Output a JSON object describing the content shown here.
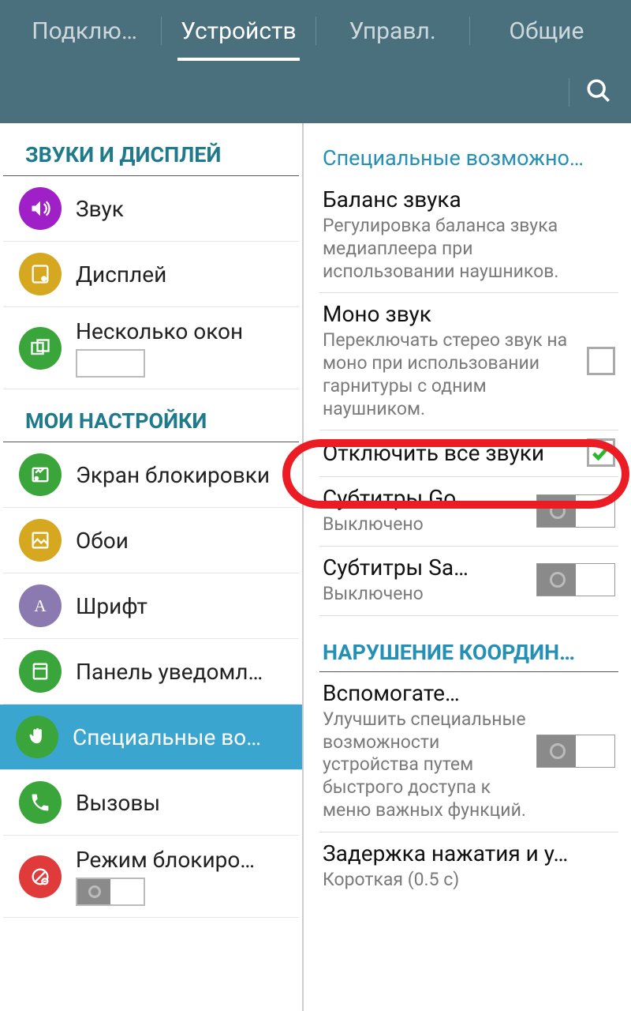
{
  "tabs": {
    "t0": "Подклю…",
    "t1": "Устройств",
    "t2": "Управл.",
    "t3": "Общие"
  },
  "sidebar": {
    "section1": "ЗВУКИ И ДИСПЛЕЙ",
    "sound": "Звук",
    "display": "Дисплей",
    "multiwindow": "Несколько окон",
    "section2": "МОИ НАСТРОЙКИ",
    "lockscreen": "Экран блокировки",
    "wallpaper": "Обои",
    "font": "Шрифт",
    "notifications": "Панель уведомл…",
    "accessibility": "Специальные во…",
    "calls": "Вызовы",
    "blocking": "Режим блокиро…"
  },
  "main": {
    "header1": "Специальные возможно…",
    "balance_title": "Баланс звука",
    "balance_desc": "Регулировка баланса звука медиаплеера при использовании наушников.",
    "mono_title": "Моно звук",
    "mono_desc": "Переключать стерео звук на моно при использовании гарнитуры с одним наушником.",
    "mute_title": "Отключить все звуки",
    "sub_go_title": "Субтитры Go…",
    "sub_go_state": "Выключено",
    "sub_sa_title": "Субтитры Sa…",
    "sub_sa_state": "Выключено",
    "header2": "НАРУШЕНИЕ КООРДИН…",
    "assist_title": "Вспомогате…",
    "assist_desc": "Улучшить специальные возможности устройства путем быстрого доступа к меню важных функций.",
    "delay_title": "Задержка нажатия и у…",
    "delay_state": "Короткая (0.5 с)"
  },
  "colors": {
    "sound": "#a020c8",
    "display": "#d6a81f",
    "multiwindow": "#3aa53a",
    "lockscreen": "#3aa53a",
    "wallpaper": "#d6a81f",
    "font": "#8a7ab0",
    "notifications": "#3aa53a",
    "accessibility": "#3aa53a",
    "calls": "#3aa53a",
    "blocking": "#e03a3a"
  }
}
